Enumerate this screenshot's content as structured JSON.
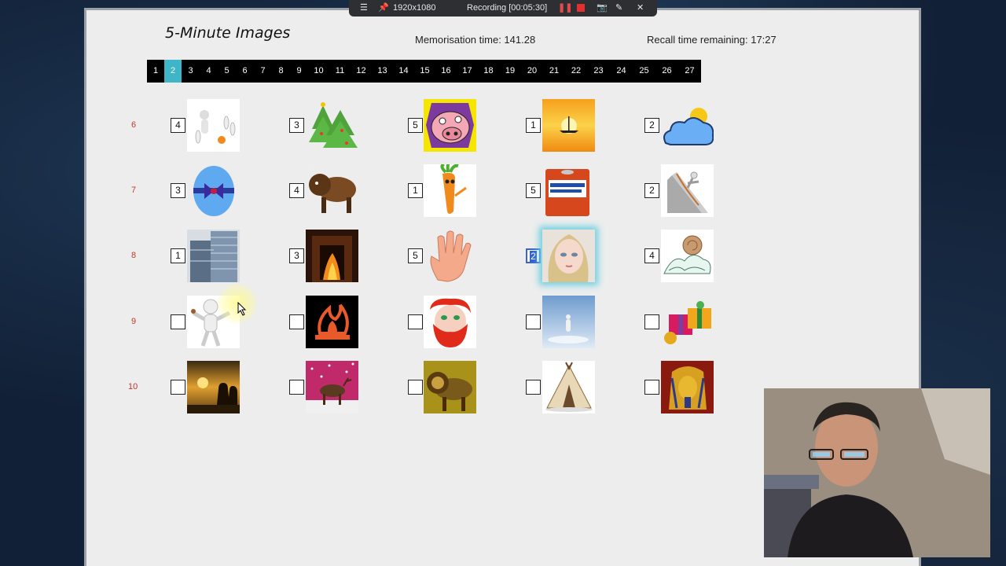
{
  "recorder": {
    "resolution": "1920x1080",
    "status": "Recording [00:05:30]"
  },
  "header": {
    "title": "5-Minute Images",
    "memorisation": "Memorisation time: 141.28",
    "recall": "Recall time remaining: 17:27"
  },
  "pages": [
    "1",
    "2",
    "3",
    "4",
    "5",
    "6",
    "7",
    "8",
    "9",
    "10",
    "11",
    "12",
    "13",
    "14",
    "15",
    "16",
    "17",
    "18",
    "19",
    "20",
    "21",
    "22",
    "23",
    "24",
    "25",
    "26",
    "27"
  ],
  "active_page": "2",
  "rows": [
    {
      "label": "6",
      "cells": [
        {
          "value": "4",
          "icon": "bowling-figure-icon"
        },
        {
          "value": "3",
          "icon": "christmas-tree-icon"
        },
        {
          "value": "5",
          "icon": "pig-face-icon"
        },
        {
          "value": "1",
          "icon": "sunset-boat-icon"
        },
        {
          "value": "2",
          "icon": "sun-cloud-icon"
        }
      ]
    },
    {
      "label": "7",
      "cells": [
        {
          "value": "3",
          "icon": "easter-egg-icon"
        },
        {
          "value": "4",
          "icon": "bison-icon"
        },
        {
          "value": "1",
          "icon": "carrot-character-icon"
        },
        {
          "value": "5",
          "icon": "motor-oil-can-icon"
        },
        {
          "value": "2",
          "icon": "figure-ramp-icon"
        }
      ]
    },
    {
      "label": "8",
      "cells": [
        {
          "value": "1",
          "icon": "skyscraper-icon"
        },
        {
          "value": "3",
          "icon": "fireplace-hall-icon"
        },
        {
          "value": "5",
          "icon": "open-hand-icon"
        },
        {
          "value": "2",
          "icon": "doll-face-icon"
        },
        {
          "value": "4",
          "icon": "snail-wave-icon"
        }
      ]
    },
    {
      "label": "9",
      "cells": [
        {
          "value": "",
          "icon": "astronaut-figure-icon"
        },
        {
          "value": "",
          "icon": "flame-logo-icon"
        },
        {
          "value": "",
          "icon": "red-beard-man-icon"
        },
        {
          "value": "",
          "icon": "sky-figure-icon"
        },
        {
          "value": "",
          "icon": "gift-boxes-icon"
        }
      ]
    },
    {
      "label": "10",
      "cells": [
        {
          "value": "",
          "icon": "sunset-couple-icon"
        },
        {
          "value": "",
          "icon": "reindeer-icon"
        },
        {
          "value": "",
          "icon": "lion-painting-icon"
        },
        {
          "value": "",
          "icon": "teepee-icon"
        },
        {
          "value": "",
          "icon": "pharaoh-mask-icon"
        }
      ]
    }
  ],
  "colors": {
    "active_page": "#3fb5c8",
    "row_label": "#c0392b",
    "focus": "#3b63c8"
  }
}
